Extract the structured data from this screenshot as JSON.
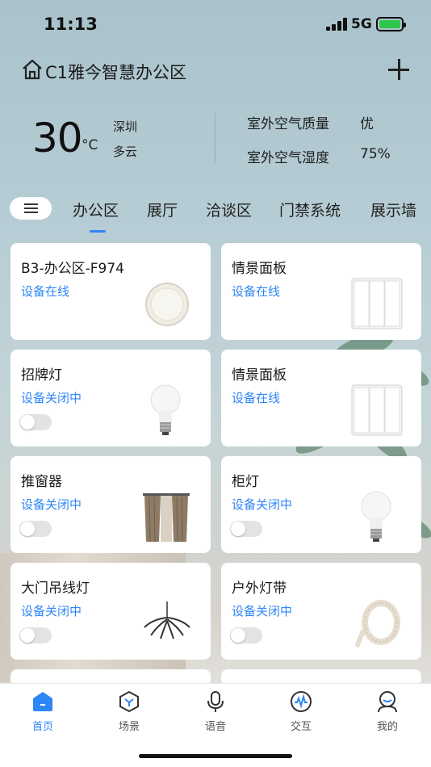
{
  "status_bar": {
    "time": "11:13",
    "network": "5G"
  },
  "header": {
    "title": "C1雅今智慧办公区",
    "home_icon": "home-icon",
    "add_icon": "plus-icon"
  },
  "weather": {
    "temperature": "30",
    "unit": "°C",
    "city": "深圳",
    "condition": "多云",
    "air_quality_label": "室外空气质量",
    "air_quality_value": "优",
    "humidity_label": "室外空气湿度",
    "humidity_value": "75%"
  },
  "tabs": [
    {
      "label": "办公区",
      "active": true
    },
    {
      "label": "展厅"
    },
    {
      "label": "洽谈区"
    },
    {
      "label": "门禁系统"
    },
    {
      "label": "展示墙"
    }
  ],
  "devices": [
    {
      "name": "B3-办公区-F974",
      "status": "设备在线",
      "icon": "round-switch-icon"
    },
    {
      "name": "情景面板",
      "status": "设备在线",
      "icon": "scene-panel-icon"
    },
    {
      "name": "招牌灯",
      "status": "设备关闭中",
      "icon": "bulb-icon",
      "on": false
    },
    {
      "name": "情景面板",
      "status": "设备在线",
      "icon": "scene-panel-icon"
    },
    {
      "name": "推窗器",
      "status": "设备关闭中",
      "icon": "curtain-icon",
      "on": false
    },
    {
      "name": "柜灯",
      "status": "设备关闭中",
      "icon": "bulb-icon",
      "on": false
    },
    {
      "name": "大门吊线灯",
      "status": "设备关闭中",
      "icon": "chandelier-icon",
      "on": false
    },
    {
      "name": "户外灯带",
      "status": "设备关闭中",
      "icon": "light-strip-icon",
      "on": false
    }
  ],
  "bottom_nav": [
    {
      "label": "首页",
      "icon": "home-tab-icon",
      "active": true
    },
    {
      "label": "场景",
      "icon": "scene-icon"
    },
    {
      "label": "语音",
      "icon": "microphone-icon"
    },
    {
      "label": "交互",
      "icon": "interaction-icon"
    },
    {
      "label": "我的",
      "icon": "profile-icon"
    }
  ],
  "colors": {
    "accent": "#2f86f6",
    "toggle_off": "#e3e3e3"
  }
}
